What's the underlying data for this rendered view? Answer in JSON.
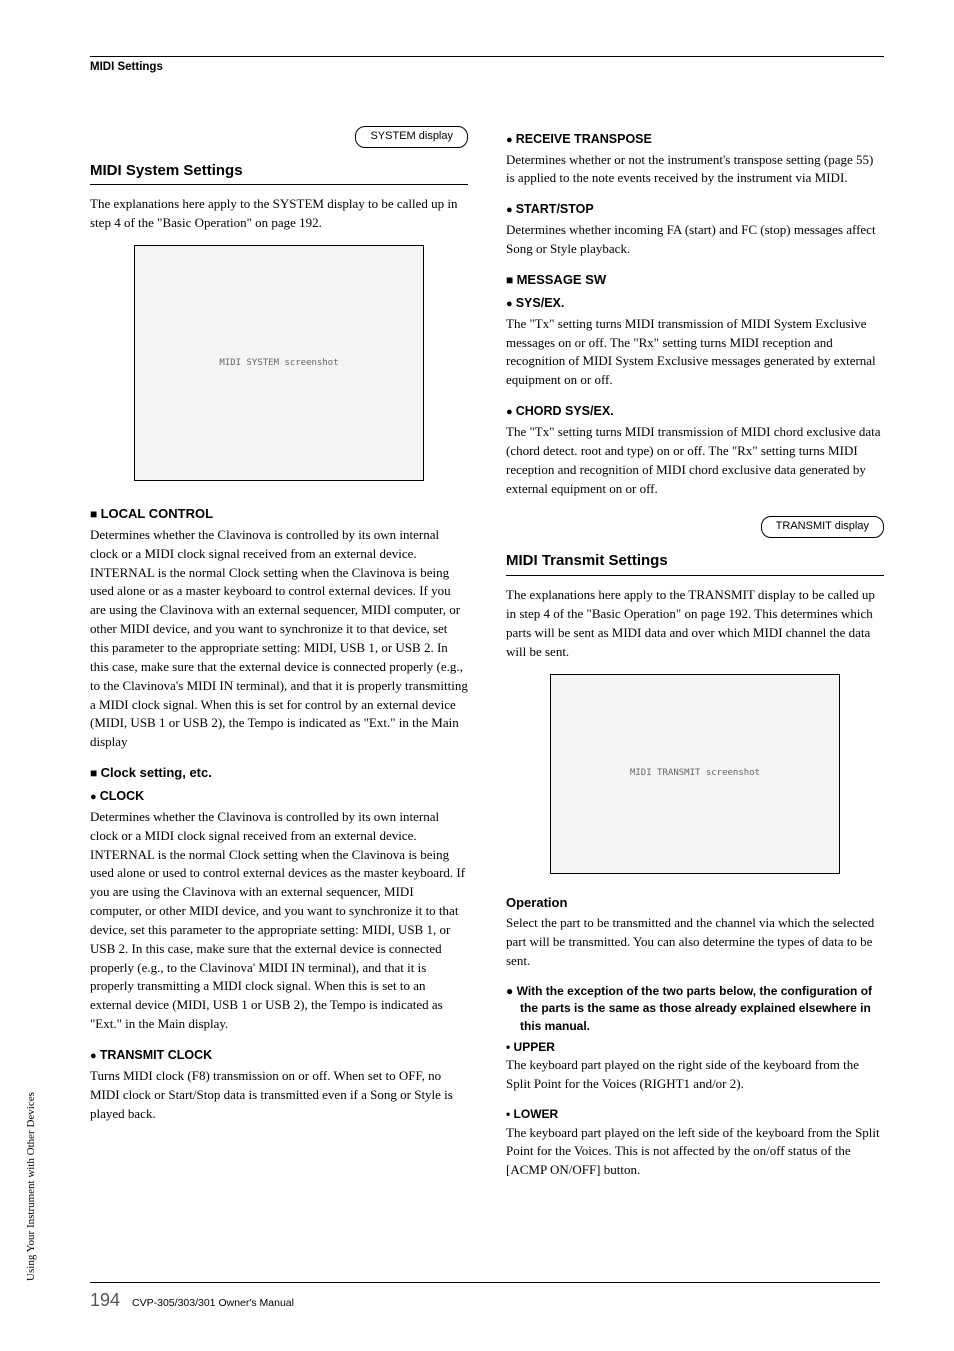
{
  "header": {
    "section": "MIDI Settings"
  },
  "sidebar": {
    "label": "Using Your Instrument with Other Devices"
  },
  "left": {
    "callout": "SYSTEM display",
    "heading": "MIDI System Settings",
    "intro": "The explanations here apply to the SYSTEM display to be called up in step 4 of the \"Basic Operation\" on page 192.",
    "screenshot_label": "MIDI SYSTEM screenshot",
    "local_control": {
      "title": "LOCAL CONTROL",
      "body": "Determines whether the Clavinova is controlled by its own internal clock or a MIDI clock signal received from an external device. INTERNAL is the normal Clock setting when the Clavinova is being used alone or as a master keyboard to control external devices. If you are using the Clavinova with an external sequencer, MIDI computer, or other MIDI device, and you want to synchronize it to that device, set this parameter to the appropriate setting: MIDI, USB 1, or USB 2. In this case, make sure that the external device is connected properly (e.g., to the Clavinova's MIDI IN terminal), and that it is properly transmitting a MIDI clock signal. When this is set for control by an external device (MIDI, USB 1 or USB 2), the Tempo is indicated as \"Ext.\" in the Main display"
    },
    "clock_setting": {
      "title": "Clock setting, etc.",
      "clock_h": "CLOCK",
      "clock_body": "Determines whether the Clavinova is controlled by its own internal clock or a MIDI clock signal received from an external device. INTERNAL is the normal Clock setting when the Clavinova is being used alone or used to control external devices as the master keyboard. If you are using the Clavinova with an external sequencer, MIDI computer, or other MIDI device, and you want to synchronize it to that device, set this parameter to the appropriate setting: MIDI, USB 1, or USB 2. In this case, make sure that the external device is connected properly (e.g., to the Clavinova' MIDI IN terminal), and that it is properly transmitting a MIDI clock signal. When this is set to an external device (MIDI, USB 1 or USB 2), the Tempo is indicated as \"Ext.\" in the Main display.",
      "tx_clock_h": "TRANSMIT CLOCK",
      "tx_clock_body": "Turns MIDI clock (F8) transmission on or off. When set to OFF, no MIDI clock or Start/Stop data is transmitted even if a Song or Style is played back."
    }
  },
  "right": {
    "recv_transpose": {
      "title": "RECEIVE TRANSPOSE",
      "body": "Determines whether or not the instrument's transpose setting (page 55) is applied to the note events received by the instrument via MIDI."
    },
    "start_stop": {
      "title": "START/STOP",
      "body": "Determines whether incoming FA (start) and FC (stop) messages affect Song or Style playback."
    },
    "message_sw": {
      "title": "MESSAGE SW",
      "sysex_h": "SYS/EX.",
      "sysex_body": "The \"Tx\" setting turns MIDI transmission of MIDI System Exclusive messages on or off. The \"Rx\" setting turns MIDI reception and recognition of MIDI System Exclusive messages generated by external equipment on or off.",
      "chord_h": "CHORD SYS/EX.",
      "chord_body": "The \"Tx\" setting turns MIDI transmission of MIDI chord exclusive data (chord detect. root and type) on or off. The \"Rx\" setting turns MIDI reception and recognition of MIDI chord exclusive data generated by external equipment on or off."
    },
    "callout": "TRANSMIT display",
    "transmit_heading": "MIDI Transmit Settings",
    "transmit_intro": "The explanations here apply to the TRANSMIT display to be called up in step 4 of the \"Basic Operation\" on page 192. This determines which parts will be sent as MIDI data and over which MIDI channel the data will be sent.",
    "screenshot_label": "MIDI TRANSMIT screenshot",
    "operation": {
      "title": "Operation",
      "body": "Select the part to be transmitted and the channel via which the selected part will be transmitted. You can also determine the types of data to be sent.",
      "exception": "With the exception of the two parts below, the configuration of the parts is the same as those already explained elsewhere in this manual.",
      "upper_h": "• UPPER",
      "upper_body": "The keyboard part played on the right side of the keyboard from the Split Point for the Voices (RIGHT1 and/or 2).",
      "lower_h": "• LOWER",
      "lower_body": "The keyboard part played on the left side of the keyboard from the Split Point for the Voices. This is not affected by the on/off status of the [ACMP ON/OFF] button."
    }
  },
  "footer": {
    "page": "194",
    "manual": "CVP-305/303/301 Owner's Manual"
  }
}
